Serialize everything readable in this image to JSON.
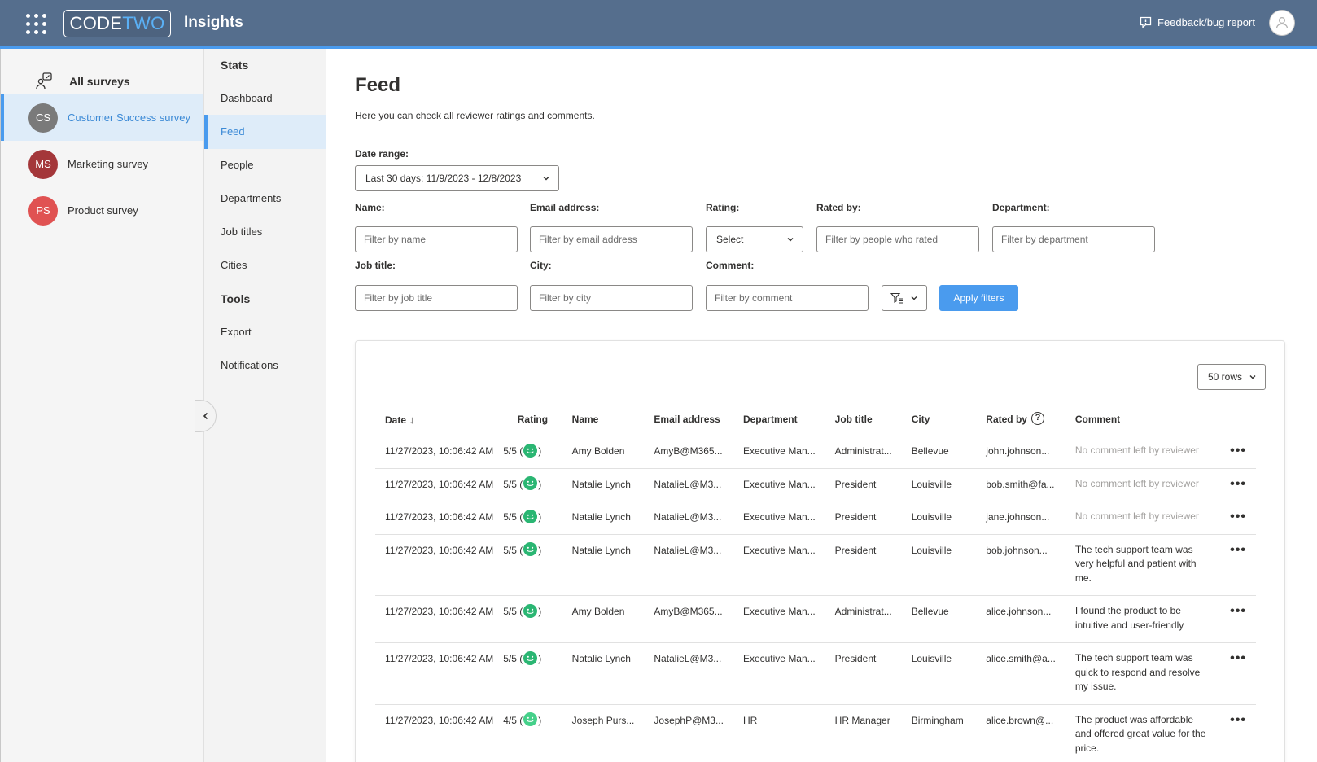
{
  "app": {
    "logo_left": "CODE",
    "logo_right": "TWO",
    "title": "Insights",
    "feedback_label": "Feedback/bug report"
  },
  "surveys": {
    "all_label": "All surveys",
    "items": [
      {
        "initials": "CS",
        "name": "Customer Success survey",
        "color": "#7a7a7a",
        "active": true
      },
      {
        "initials": "MS",
        "name": "Marketing survey",
        "color": "#a4373a",
        "active": false
      },
      {
        "initials": "PS",
        "name": "Product survey",
        "color": "#e05252",
        "active": false
      }
    ]
  },
  "nav": {
    "stats_heading": "Stats",
    "stats_items": [
      "Dashboard",
      "Feed",
      "People",
      "Departments",
      "Job titles",
      "Cities"
    ],
    "tools_heading": "Tools",
    "tools_items": [
      "Export",
      "Notifications"
    ],
    "active": "Feed"
  },
  "page": {
    "title": "Feed",
    "description": "Here you can check all reviewer ratings and comments."
  },
  "filters": {
    "date_range_label": "Date range:",
    "date_range_value": "Last 30 days: 11/9/2023 - 12/8/2023",
    "name_label": "Name:",
    "name_placeholder": "Filter by name",
    "email_label": "Email address:",
    "email_placeholder": "Filter by email address",
    "rating_label": "Rating:",
    "rating_value": "Select",
    "rated_by_label": "Rated by:",
    "rated_by_placeholder": "Filter by people who rated",
    "department_label": "Department:",
    "department_placeholder": "Filter by department",
    "job_title_label": "Job title:",
    "job_title_placeholder": "Filter by job title",
    "city_label": "City:",
    "city_placeholder": "Filter by city",
    "comment_label": "Comment:",
    "comment_placeholder": "Filter by comment",
    "apply_label": "Apply filters"
  },
  "table": {
    "rows_per_page": "50 rows",
    "columns": [
      "Date",
      "Rating",
      "Name",
      "Email address",
      "Department",
      "Job title",
      "City",
      "Rated by",
      "Comment"
    ],
    "rows": [
      {
        "date": "11/27/2023, 10:06:42 AM",
        "rating": "5/5",
        "name": "Amy Bolden",
        "email": "AmyB@M365...",
        "department": "Executive Man...",
        "job_title": "Administrat...",
        "city": "Bellevue",
        "rated_by": "john.johnson...",
        "comment": "No comment left by reviewer",
        "comment_empty": true
      },
      {
        "date": "11/27/2023, 10:06:42 AM",
        "rating": "5/5",
        "name": "Natalie Lynch",
        "email": "NatalieL@M3...",
        "department": "Executive Man...",
        "job_title": "President",
        "city": "Louisville",
        "rated_by": "bob.smith@fa...",
        "comment": "No comment left by reviewer",
        "comment_empty": true
      },
      {
        "date": "11/27/2023, 10:06:42 AM",
        "rating": "5/5",
        "name": "Natalie Lynch",
        "email": "NatalieL@M3...",
        "department": "Executive Man...",
        "job_title": "President",
        "city": "Louisville",
        "rated_by": "jane.johnson...",
        "comment": "No comment left by reviewer",
        "comment_empty": true
      },
      {
        "date": "11/27/2023, 10:06:42 AM",
        "rating": "5/5",
        "name": "Natalie Lynch",
        "email": "NatalieL@M3...",
        "department": "Executive Man...",
        "job_title": "President",
        "city": "Louisville",
        "rated_by": "bob.johnson...",
        "comment": "The tech support team was very helpful and patient with me.",
        "comment_empty": false
      },
      {
        "date": "11/27/2023, 10:06:42 AM",
        "rating": "5/5",
        "name": "Amy Bolden",
        "email": "AmyB@M365...",
        "department": "Executive Man...",
        "job_title": "Administrat...",
        "city": "Bellevue",
        "rated_by": "alice.johnson...",
        "comment": "I found the product to be intuitive and user-friendly",
        "comment_empty": false
      },
      {
        "date": "11/27/2023, 10:06:42 AM",
        "rating": "5/5",
        "name": "Natalie Lynch",
        "email": "NatalieL@M3...",
        "department": "Executive Man...",
        "job_title": "President",
        "city": "Louisville",
        "rated_by": "alice.smith@a...",
        "comment": "The tech support team was quick to respond and resolve my issue.",
        "comment_empty": false
      },
      {
        "date": "11/27/2023, 10:06:42 AM",
        "rating": "4/5",
        "name": "Joseph Purs...",
        "email": "JosephP@M3...",
        "department": "HR",
        "job_title": "HR Manager",
        "city": "Birmingham",
        "rated_by": "alice.brown@...",
        "comment": "The product was affordable and offered great value for the price.",
        "comment_empty": false
      }
    ]
  },
  "colors": {
    "topbar": "#556e8d",
    "accent": "#4a9bee",
    "smiley_happy": "#2bb673",
    "smiley_good": "#46d08a"
  }
}
